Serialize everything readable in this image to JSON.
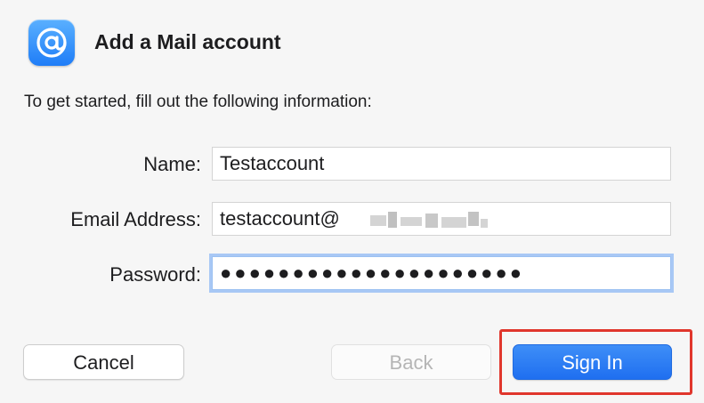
{
  "dialog": {
    "icon": "at-sign-mail-icon",
    "title": "Add a Mail account",
    "instructions": "To get started, fill out the following information:"
  },
  "form": {
    "name_label": "Name:",
    "name_value": "Testaccount",
    "email_label": "Email Address:",
    "email_value": "testaccount@",
    "password_label": "Password:",
    "password_value": "●●●●●●●●●●●●●●●●●●●●●"
  },
  "buttons": {
    "cancel": "Cancel",
    "back": "Back",
    "sign_in": "Sign In"
  },
  "colors": {
    "accent": "#1f6ff0",
    "highlight": "#e0362c",
    "focus_ring": "#a8c8f5"
  }
}
